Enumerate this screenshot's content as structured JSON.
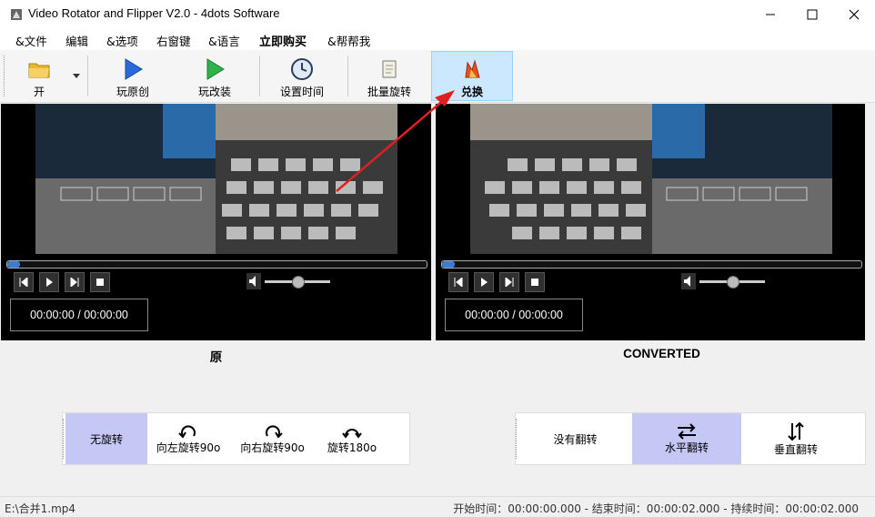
{
  "window": {
    "title": "Video Rotator and Flipper V2.0 - 4dots Software"
  },
  "menu": [
    "&文件",
    "编辑",
    "&选项",
    "右窗键",
    "&语言",
    "立即购买",
    "&帮帮我"
  ],
  "toolbar": {
    "open": "开",
    "play_original": "玩原创",
    "play_converted": "玩改装",
    "set_time": "设置时间",
    "batch_rotate": "批量旋转",
    "convert": "兑换"
  },
  "left_pane": {
    "time": "00:00:00 / 00:00:00",
    "label": "原"
  },
  "right_pane": {
    "time": "00:00:00 / 00:00:00",
    "label": "CONVERTED"
  },
  "rotation": [
    "无旋转",
    "向左旋转90o",
    "向右旋转90o",
    "旋转180o"
  ],
  "flip": [
    "没有翻转",
    "水平翻转",
    "垂直翻转"
  ],
  "status": {
    "file": "E:\\合并1.mp4",
    "times": "开始时间：00:00:00.000 - 结束时间：00:00:02.000 - 持续时间：00:00:02.000"
  },
  "colors": {
    "selected": "#c5c7f5",
    "active_toolbar": "#cce8ff",
    "arrow": "#e02020"
  }
}
